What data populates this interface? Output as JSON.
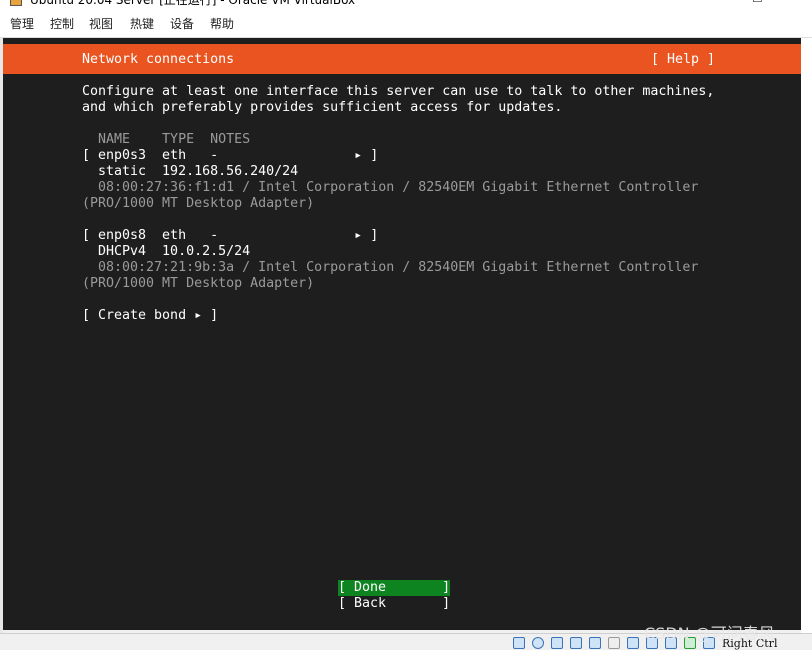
{
  "window": {
    "title": "Ubuntu 20.04 Server [正在运行] - Oracle VM VirtualBox",
    "controls": {
      "minimize": "—",
      "maximize": "☐"
    }
  },
  "menu": [
    "管理",
    "控制",
    "视图",
    "热键",
    "设备",
    "帮助"
  ],
  "installer": {
    "header_title": "Network connections",
    "help_label": "[ Help ]",
    "description_line1": "Configure at least one interface this server can use to talk to other machines,",
    "description_line2": "and which preferably provides sufficient access for updates.",
    "columns": "  NAME    TYPE  NOTES",
    "interfaces": [
      {
        "row": "[ enp0s3  eth   -                 ▸ ]",
        "addr": "  static  192.168.56.240/24",
        "info1": "  08:00:27:36:f1:d1 / Intel Corporation / 82540EM Gigabit Ethernet Controller",
        "info2": "(PRO/1000 MT Desktop Adapter)"
      },
      {
        "row": "[ enp0s8  eth   -                 ▸ ]",
        "addr": "  DHCPv4  10.0.2.5/24",
        "info1": "  08:00:27:21:9b:3a / Intel Corporation / 82540EM Gigabit Ethernet Controller",
        "info2": "(PRO/1000 MT Desktop Adapter)"
      }
    ],
    "create_bond": "[ Create bond ▸ ]",
    "done_button": "[ Done       ]",
    "back_button": "[ Back       ]"
  },
  "statusbar": {
    "host_key": "Right Ctrl"
  },
  "watermark": "CSDN @可问春风"
}
